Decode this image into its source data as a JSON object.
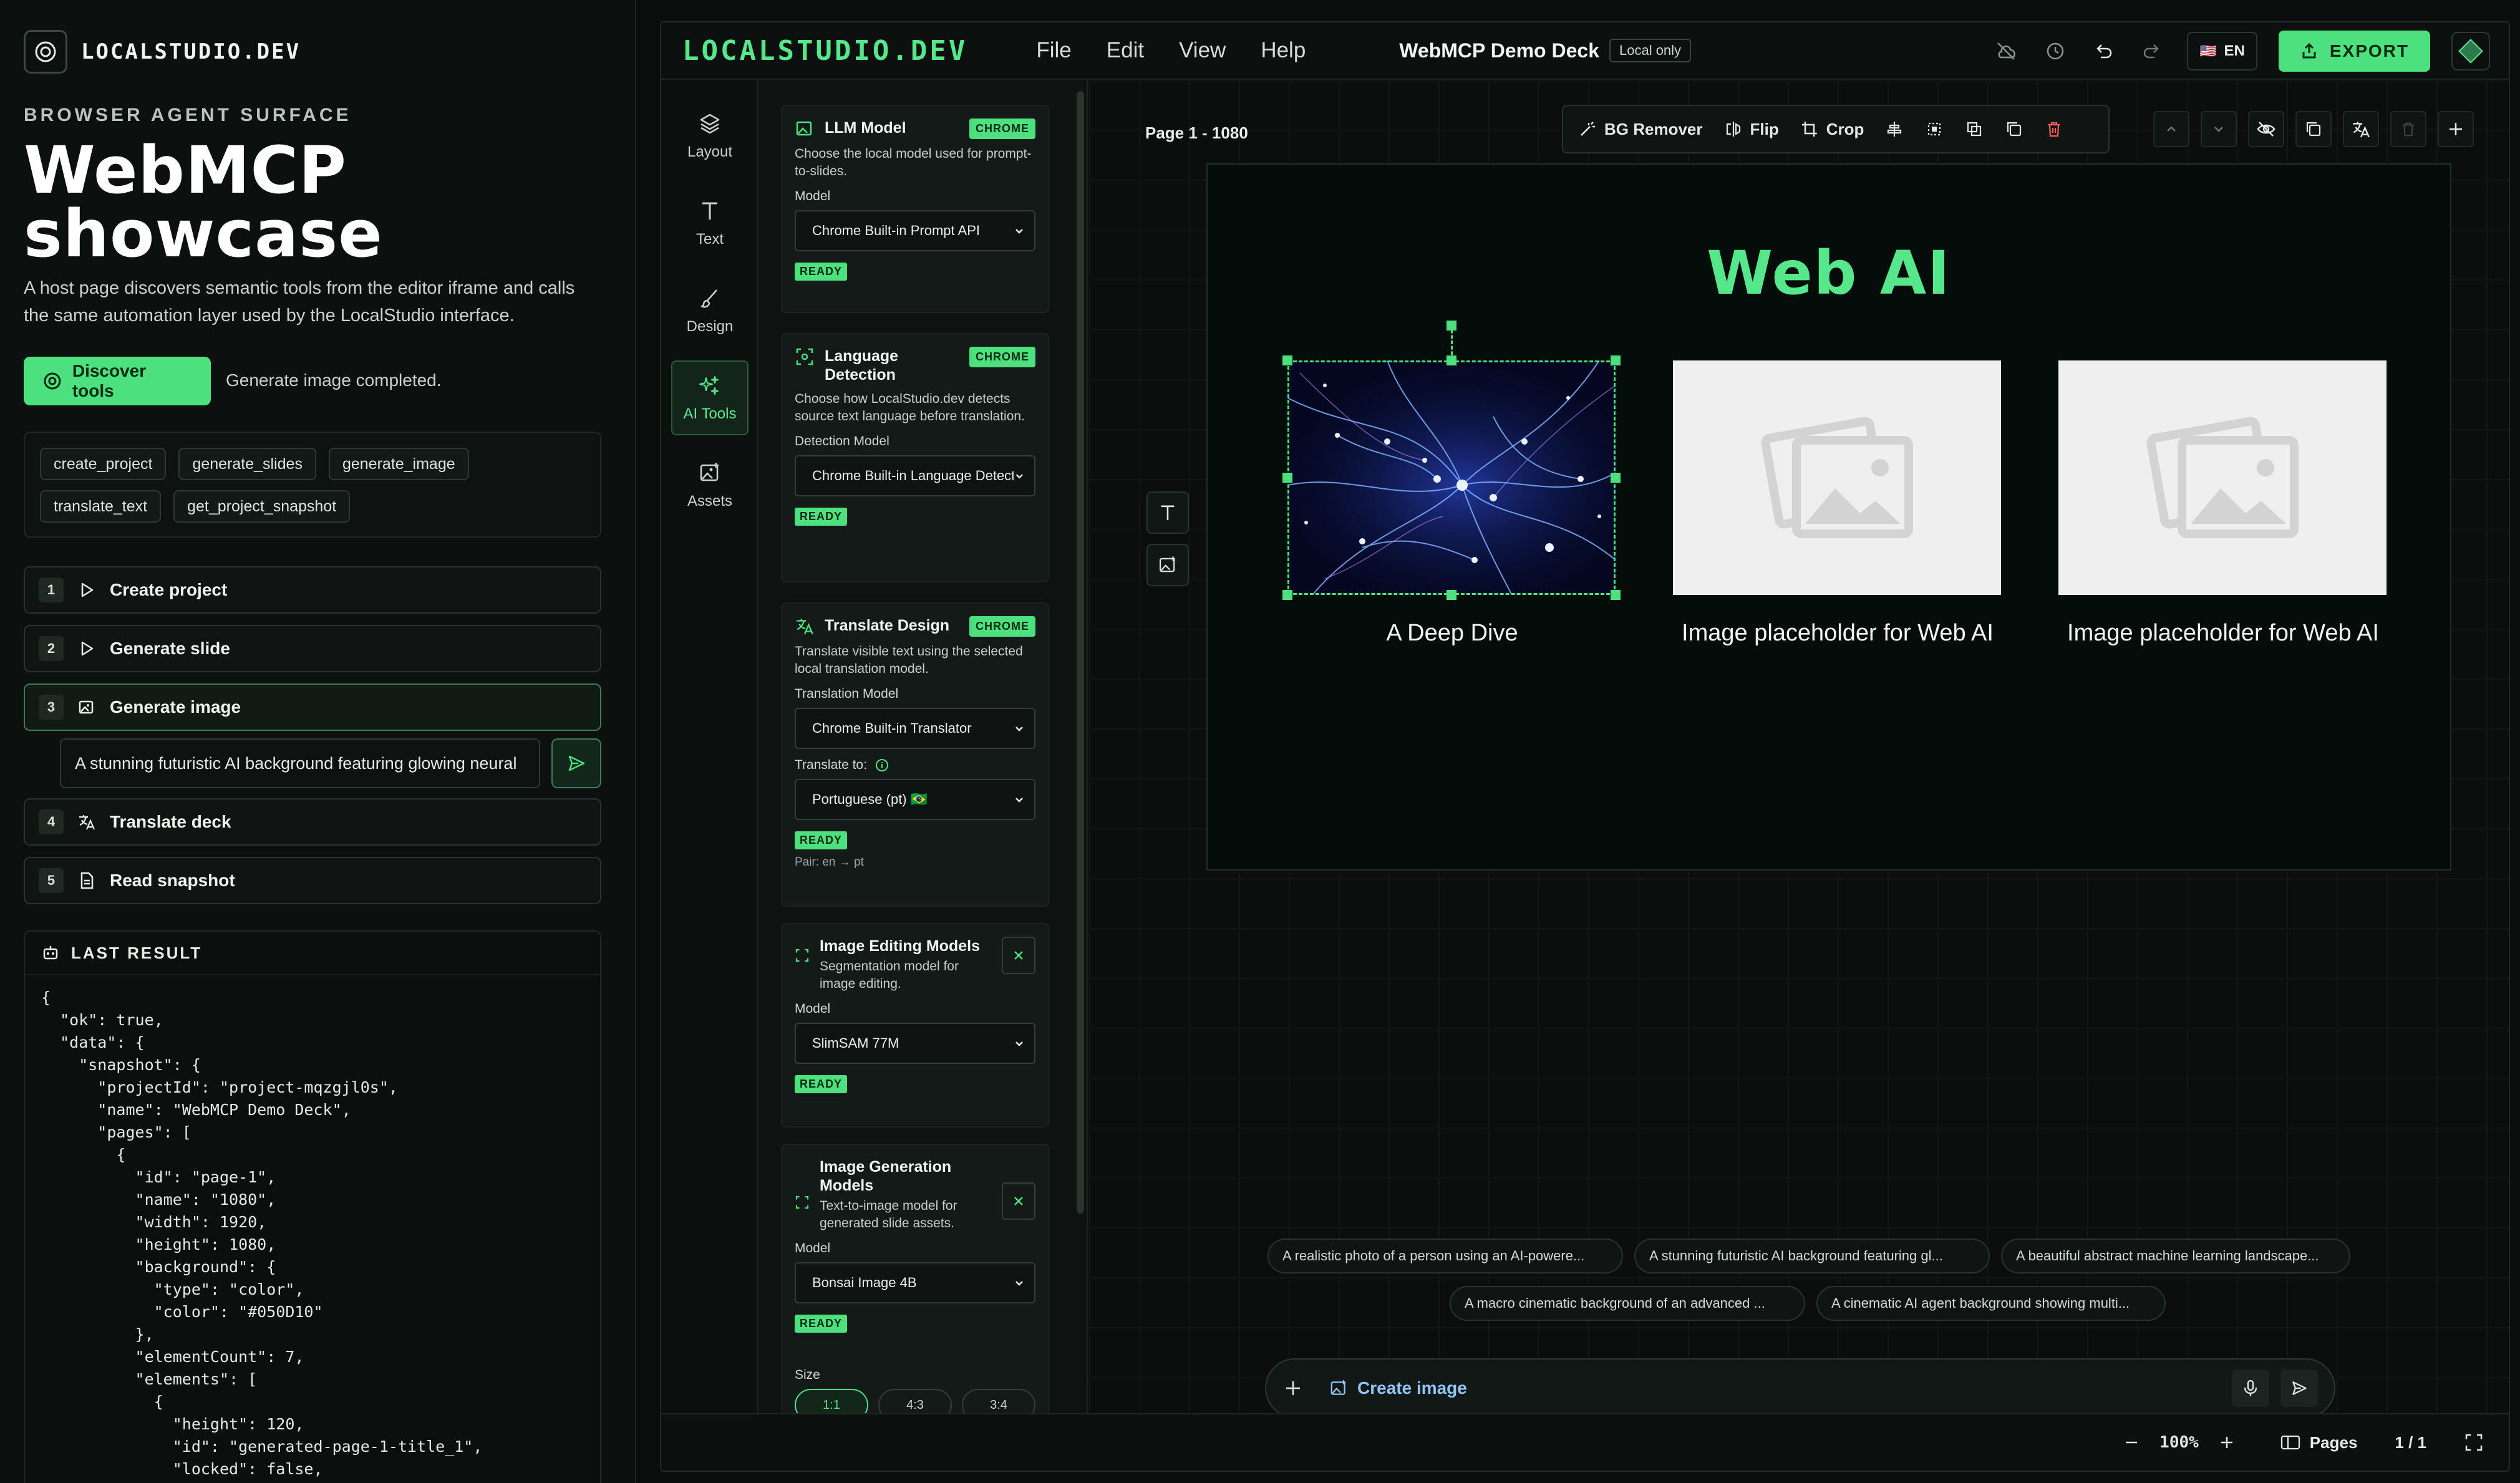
{
  "host": {
    "brand": "LOCALSTUDIO.DEV",
    "eyebrow": "BROWSER AGENT SURFACE",
    "title_line1": "WebMCP",
    "title_line2": "showcase",
    "lead": "A host page discovers semantic tools from the editor iframe and calls the same automation layer used by the LocalStudio interface.",
    "discover_label": "Discover tools",
    "status": "Generate image completed.",
    "tools": [
      "create_project",
      "generate_slides",
      "generate_image",
      "translate_text",
      "get_project_snapshot"
    ],
    "steps": [
      {
        "num": "1",
        "label": "Create project",
        "icon": "play-icon"
      },
      {
        "num": "2",
        "label": "Generate slide",
        "icon": "play-icon"
      },
      {
        "num": "3",
        "label": "Generate image",
        "icon": "image-plus-icon"
      },
      {
        "num": "4",
        "label": "Translate deck",
        "icon": "translate-icon"
      },
      {
        "num": "5",
        "label": "Read snapshot",
        "icon": "document-icon"
      }
    ],
    "prompt_value": "A stunning futuristic AI background featuring glowing neural",
    "last_result_label": "LAST RESULT",
    "last_result_json": "{\n  \"ok\": true,\n  \"data\": {\n    \"snapshot\": {\n      \"projectId\": \"project-mqzgjl0s\",\n      \"name\": \"WebMCP Demo Deck\",\n      \"pages\": [\n        {\n          \"id\": \"page-1\",\n          \"name\": \"1080\",\n          \"width\": 1920,\n          \"height\": 1080,\n          \"background\": {\n            \"type\": \"color\",\n            \"color\": \"#050D10\"\n          },\n          \"elementCount\": 7,\n          \"elements\": [\n            {\n              \"height\": 120,\n              \"id\": \"generated-page-1-title_1\",\n              \"locked\": false,"
  },
  "editor": {
    "logo": "LOCALSTUDIO.DEV",
    "menu": [
      "File",
      "Edit",
      "View",
      "Help"
    ],
    "doc_title": "WebMCP Demo Deck",
    "doc_badge": "Local only",
    "lang": "EN",
    "export_label": "EXPORT",
    "rail": [
      {
        "label": "Layout",
        "icon": "layers-icon"
      },
      {
        "label": "Text",
        "icon": "text-icon"
      },
      {
        "label": "Design",
        "icon": "brush-icon"
      },
      {
        "label": "AI Tools",
        "icon": "sparkles-icon",
        "active": true
      },
      {
        "label": "Assets",
        "icon": "image-plus-icon"
      }
    ],
    "ai_panel": {
      "llm": {
        "title": "LLM Model",
        "badge": "CHROME",
        "desc": "Choose the local model used for prompt-to-slides.",
        "label": "Model",
        "value": "Chrome Built-in Prompt API",
        "status": "READY"
      },
      "lang_detect": {
        "title": "Language Detection",
        "badge": "CHROME",
        "desc": "Choose how LocalStudio.dev detects source text language before translation.",
        "label": "Detection Model",
        "value": "Chrome Built-in Language Detector",
        "status": "READY"
      },
      "translate": {
        "title": "Translate Design",
        "badge": "CHROME",
        "desc": "Translate visible text using the selected local translation model.",
        "label": "Translation Model",
        "value": "Chrome Built-in Translator",
        "to_label": "Translate to:",
        "to_value": "Portuguese (pt) 🇧🇷",
        "status": "READY",
        "pair": "Pair: en → pt"
      },
      "img_edit": {
        "title": "Image Editing Models",
        "desc": "Segmentation model for image editing.",
        "label": "Model",
        "value": "SlimSAM 77M",
        "status": "READY"
      },
      "img_gen": {
        "title": "Image Generation Models",
        "desc": "Text-to-image model for generated slide assets.",
        "label": "Model",
        "value": "Bonsai Image 4B",
        "status": "READY",
        "size_label": "Size",
        "sizes": [
          "1:1",
          "4:3",
          "3:4"
        ]
      }
    },
    "canvas": {
      "page_label": "Page 1 - 1080",
      "ctx_tools": [
        "BG Remover",
        "Flip",
        "Crop"
      ],
      "slide_title": "Web AI",
      "captions": [
        "A Deep Dive",
        "Image placeholder for Web AI",
        "Image placeholder for Web AI"
      ],
      "suggestions_row1": [
        "A realistic photo of a person using an AI-powere...",
        "A stunning futuristic AI background featuring gl...",
        "A beautiful abstract machine learning landscape..."
      ],
      "suggestions_row2": [
        "A macro cinematic background of an advanced ...",
        "A cinematic AI agent background showing multi..."
      ],
      "composer_label": "Create image"
    },
    "status_bar": {
      "zoom": "100%",
      "pages_label": "Pages",
      "page_count": "1 / 1"
    }
  },
  "colors": {
    "accent": "#4ce07f",
    "accent_text": "#56e68c",
    "bg": "#0a0d0c"
  }
}
